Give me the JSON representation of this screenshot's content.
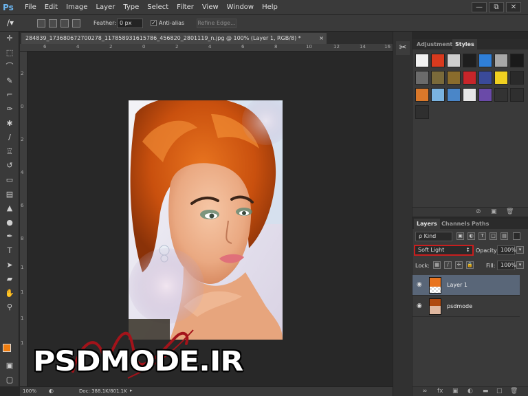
{
  "app": {
    "logo": "Ps"
  },
  "menu": [
    "File",
    "Edit",
    "Image",
    "Layer",
    "Type",
    "Select",
    "Filter",
    "View",
    "Window",
    "Help"
  ],
  "window_controls": [
    "—",
    "⧉",
    "✕"
  ],
  "options": {
    "feather_label": "Feather:",
    "feather_value": "0 px",
    "antialias_label": "Anti-alias",
    "refine_edge": "Refine Edge..."
  },
  "document": {
    "tab_title": "284839_173680672700278_117858931615786_456820_2801119_n.jpg @ 100% (Layer 1, RGB/8) *",
    "close": "×",
    "ruler_top": [
      "6",
      "4",
      "2",
      "0",
      "2",
      "4",
      "6",
      "8",
      "10",
      "12",
      "14",
      "16"
    ],
    "ruler_left": [
      "2",
      "0",
      "2",
      "4",
      "6",
      "8",
      "1",
      "1",
      "1",
      "1"
    ],
    "zoom": "100%",
    "doc_info": "Doc: 388.1K/801.1K"
  },
  "panels": {
    "adjustments_tab": "Adjustment",
    "styles_tab": "Styles",
    "style_swatches": [
      "#f2f2f2",
      "#d83a1e",
      "#cfcfcf",
      "#1e1e1e",
      "#2f7fd8",
      "#a8a8a8",
      "#1a1a1a",
      "#6b6b6b",
      "#7a6a3a",
      "#8a6c2c",
      "#c8252a",
      "#3a4a9a",
      "#f0d020",
      "#2a2a2a",
      "#d9782a",
      "#7ab3e0",
      "#4a86c8",
      "#e6e6e6",
      "#6a4aa8",
      "#333333",
      "#2f2f2f",
      "#2f2f2f"
    ],
    "layers_tab": "Layers",
    "channels_tab": "Channels",
    "paths_tab": "Paths",
    "kind": "ρ Kind",
    "blend_mode": "Soft Light",
    "opacity_label": "Opacity:",
    "opacity_value": "100%",
    "lock_label": "Lock:",
    "fill_label": "Fill:",
    "fill_value": "100%",
    "layers": [
      {
        "name": "Layer 1",
        "selected": true
      },
      {
        "name": "psdmode",
        "selected": false
      }
    ]
  },
  "watermark": {
    "text": "PSDMODE.IR"
  }
}
